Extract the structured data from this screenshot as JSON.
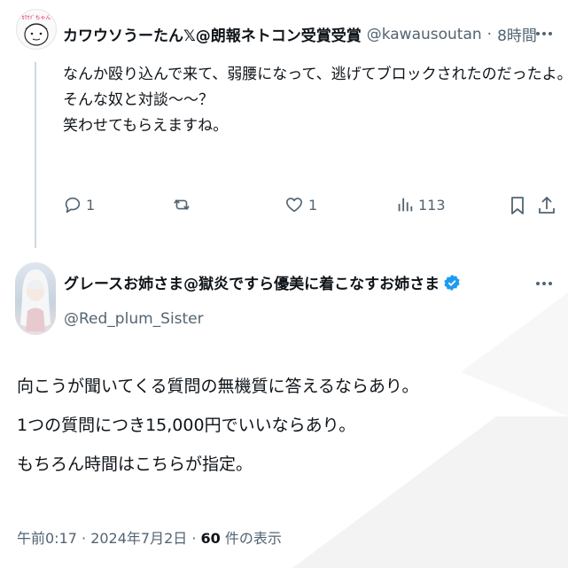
{
  "reply_tweet": {
    "display_name": "カワウソうーたん𝕏@朗報ネトコン受賞受賞",
    "handle": "@kawausoutan",
    "separator": "·",
    "time_ago": "8時間",
    "avatar_text": "ｶﾜｳｿﾞちゃん",
    "text_lines": [
      "なんか殴り込んで来て、弱腰になって、逃げてブロックされたのだったよ。",
      "そんな奴と対談〜〜？",
      "笑わせてもらえますね。"
    ],
    "actions": {
      "replies": "1",
      "retweets": "",
      "likes": "1",
      "views": "113"
    }
  },
  "main_tweet": {
    "display_name": "グレースお姉さま@獄炎ですら優美に着こなすお姉さま",
    "handle": "@Red_plum_Sister",
    "verified": true,
    "text_lines": [
      "向こうが聞いてくる質問の無機質に答えるならあり。",
      "1つの質問につき15,000円でいいならあり。",
      "もちろん時間はこちらが指定。"
    ],
    "timestamp": "午前0:17 · 2024年7月2日 · ",
    "view_count": "60",
    "view_label": " 件の表示"
  },
  "colors": {
    "text_primary": "#0f1419",
    "text_secondary": "#536471",
    "verified_blue": "#1d9bf0",
    "thread_line": "#cfd9de"
  },
  "icons": [
    "more-icon",
    "reply-icon",
    "retweet-icon",
    "like-icon",
    "views-icon",
    "bookmark-icon",
    "share-icon",
    "verified-badge-icon"
  ]
}
